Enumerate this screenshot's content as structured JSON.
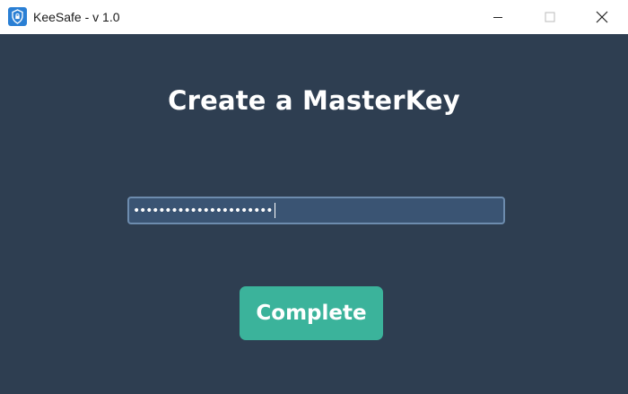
{
  "window": {
    "title": "KeeSafe - v 1.0",
    "icon": "shield-lock-icon",
    "controls": [
      "minimize-icon",
      "maximize-icon",
      "close-icon"
    ]
  },
  "main": {
    "heading": "Create a MasterKey",
    "password": {
      "masked_value": "••••••••••••••••••••••"
    },
    "complete_button": "Complete"
  },
  "colors": {
    "background": "#2e3e51",
    "titlebar": "#ffffff",
    "input_bg": "#3a5473",
    "input_border": "#6d8cae",
    "button": "#3bb39b",
    "text": "#ffffff"
  }
}
